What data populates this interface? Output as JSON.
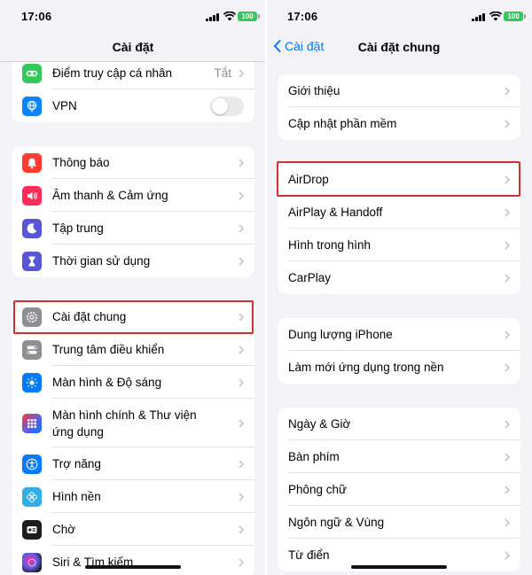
{
  "status": {
    "time": "17:06",
    "battery": "100"
  },
  "left": {
    "title": "Cài đặt",
    "group1": [
      {
        "label": "Điểm truy cập cá nhân",
        "value": "Tắt",
        "icon": "link-icon",
        "color": "#34c759"
      },
      {
        "label": "VPN",
        "icon": "globe-icon",
        "color": "#0a84ff",
        "toggle": false
      }
    ],
    "group2": [
      {
        "label": "Thông báo",
        "icon": "bell-icon",
        "color": "#ff3b30"
      },
      {
        "label": "Âm thanh & Cảm ứng",
        "icon": "speaker-icon",
        "color": "#ff2d55"
      },
      {
        "label": "Tập trung",
        "icon": "moon-icon",
        "color": "#5856d6"
      },
      {
        "label": "Thời gian sử dụng",
        "icon": "hourglass-icon",
        "color": "#5856d6"
      }
    ],
    "group3": [
      {
        "label": "Cài đặt chung",
        "icon": "gear-icon",
        "color": "#8e8e93"
      },
      {
        "label": "Trung tâm điều khiển",
        "icon": "switches-icon",
        "color": "#8e8e93"
      },
      {
        "label": "Màn hình & Độ sáng",
        "icon": "sun-icon",
        "color": "#007aff"
      },
      {
        "label": "Màn hình chính & Thư viện ứng dụng",
        "icon": "grid-icon",
        "color": "#5e5ce6"
      },
      {
        "label": "Trợ năng",
        "icon": "accessibility-icon",
        "color": "#007aff"
      },
      {
        "label": "Hình nền",
        "icon": "flower-icon",
        "color": "#32ade6"
      },
      {
        "label": "Chờ",
        "icon": "standby-icon",
        "color": "#1c1c1e"
      },
      {
        "label": "Siri & Tìm kiếm",
        "icon": "siri-icon",
        "color": "#2c2c2e"
      }
    ]
  },
  "right": {
    "back_label": "Cài đặt",
    "title": "Cài đặt chung",
    "group1": [
      "Giới thiệu",
      "Cập nhật phần mềm"
    ],
    "group2": [
      "AirDrop",
      "AirPlay & Handoff",
      "Hình trong hình",
      "CarPlay"
    ],
    "group3": [
      "Dung lượng iPhone",
      "Làm mới ứng dụng trong nền"
    ],
    "group4": [
      "Ngày & Giờ",
      "Bàn phím",
      "Phông chữ",
      "Ngôn ngữ & Vùng",
      "Từ điển"
    ]
  },
  "colors": {
    "accent": "#007aff",
    "highlight": "#d32f2f"
  }
}
